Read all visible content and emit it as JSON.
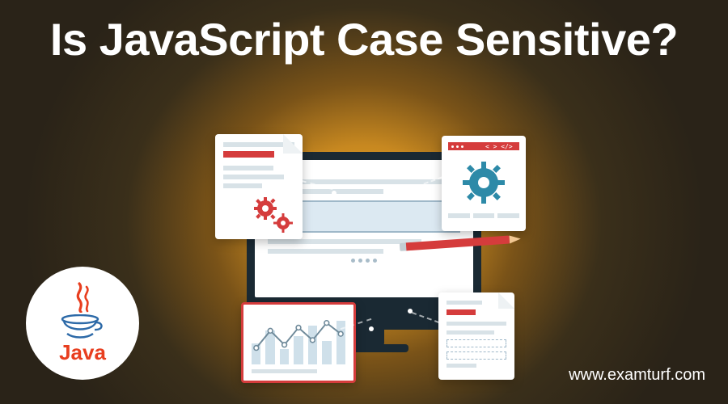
{
  "title": "Is JavaScript Case Sensitive?",
  "watermark": "www.examturf.com",
  "java_logo": {
    "text": "Java"
  }
}
